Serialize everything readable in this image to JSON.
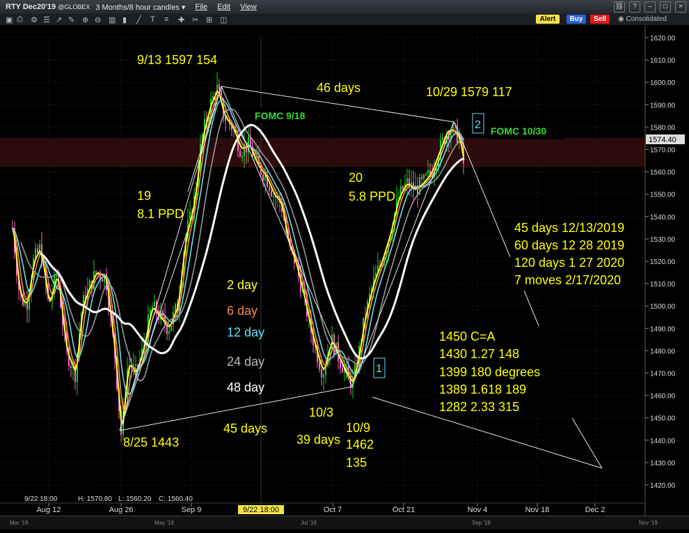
{
  "window": {
    "title": "RTY Dec20'19",
    "exchange": "@GLOBEX",
    "timeframe": "3 Months/8 hour candles",
    "menu": [
      "File",
      "Edit",
      "View"
    ]
  },
  "toolbar_right": {
    "alert": "Alert",
    "buy": "Buy",
    "sell": "Sell",
    "consolidated": "Consolidated"
  },
  "price_axis": {
    "ticks": [
      "1620.00",
      "1610.00",
      "1600.00",
      "1590.00",
      "1580.00",
      "1570.00",
      "1560.00",
      "1550.00",
      "1540.00",
      "1530.00",
      "1520.00",
      "1510.00",
      "1500.00",
      "1490.00",
      "1480.00",
      "1470.00",
      "1460.00",
      "1450.00",
      "1440.00",
      "1430.00",
      "1420.00"
    ],
    "last_price": "1574.40"
  },
  "time_axis": {
    "ticks": [
      "Aug 12",
      "Aug 26",
      "Sep 9",
      "Oct 7",
      "Oct 21",
      "Nov 4",
      "Nov 18",
      "Dec 2"
    ],
    "highlight": "9/22 18:00",
    "overview_ticks": [
      "Mar '19",
      "May '19",
      "Jul '19",
      "Sep '19",
      "Nov '19"
    ]
  },
  "ohlc": {
    "date": "9/22 18:00",
    "h": "H: 1570.80",
    "l": "L: 1560.20",
    "c": "C: 1560.40"
  },
  "annotations": {
    "top_left": "9/13 1597 154",
    "days_46": "46 days",
    "top_right": "10/29 1579 117",
    "fomc1": "FOMC 9/18",
    "fomc2": "FOMC 10/30",
    "box1": "1",
    "box2": "2",
    "left_count": "19",
    "left_ppd": "8.1 PPD",
    "mid_count": "20",
    "mid_ppd": "5.8 PPD",
    "legend_2": "2 day",
    "legend_6": "6 day",
    "legend_12": "12 day",
    "legend_24": "24 day",
    "legend_48": "48 day",
    "low_aug": "8/25 1443",
    "days_45": "45 days",
    "oct3": "10/3",
    "days_39": "39 days",
    "oct9": "10/9",
    "oct9_price": "1462",
    "oct9_pts": "135",
    "proj1": "45 days 12/13/2019",
    "proj2": "60 days 12 28 2019",
    "proj3": "120 days 1 27 2020",
    "proj4": "7 moves 2/17/2020",
    "tgt1": "1450 C=A",
    "tgt2": "1430 1.27 148",
    "tgt3": "1399 180 degrees",
    "tgt4": "1389  1.618 189",
    "tgt5": "1282  2.33 315"
  },
  "colors": {
    "bull": "#22cc22",
    "bear": "#ff66cc",
    "ma2": "#ffff33",
    "ma6": "#f28a4e",
    "ma12": "#66e0f0",
    "ma24": "#9a9a9a",
    "ma48": "#ffffff",
    "text_yellow": "#ffff00",
    "fomc_green": "#33dd33"
  },
  "chart_data": {
    "type": "line",
    "title": "RTY Dec20'19 @GLOBEX 3 Months/8 hour candles",
    "xlabel": "",
    "ylabel": "",
    "ylim": [
      1420,
      1620
    ],
    "x": [
      "Aug 12",
      "Aug 26",
      "Sep 9",
      "Sep 13",
      "Sep 22",
      "Oct 3",
      "Oct 9",
      "Oct 21",
      "Oct 29",
      "Nov 4"
    ],
    "series": [
      {
        "name": "2 day",
        "values": [
          1505,
          1445,
          1580,
          1590,
          1560,
          1470,
          1465,
          1555,
          1578,
          null
        ]
      },
      {
        "name": "6 day",
        "values": [
          1510,
          1460,
          1555,
          1585,
          1565,
          1485,
          1475,
          1545,
          1572,
          null
        ]
      },
      {
        "name": "12 day",
        "values": [
          1505,
          1475,
          1530,
          1575,
          1560,
          1500,
          1490,
          1535,
          1565,
          null
        ]
      },
      {
        "name": "24 day",
        "values": [
          1520,
          1490,
          1500,
          1545,
          1555,
          1525,
          1515,
          1525,
          1545,
          null
        ]
      },
      {
        "name": "48 day",
        "values": [
          1525,
          1510,
          1508,
          1525,
          1540,
          1530,
          1518,
          1520,
          1535,
          null
        ]
      }
    ],
    "annotated_points": [
      {
        "date": "8/25",
        "price": 1443
      },
      {
        "date": "9/13",
        "price": 1597
      },
      {
        "date": "10/9",
        "price": 1462
      },
      {
        "date": "10/29",
        "price": 1579
      }
    ],
    "grid": true
  }
}
